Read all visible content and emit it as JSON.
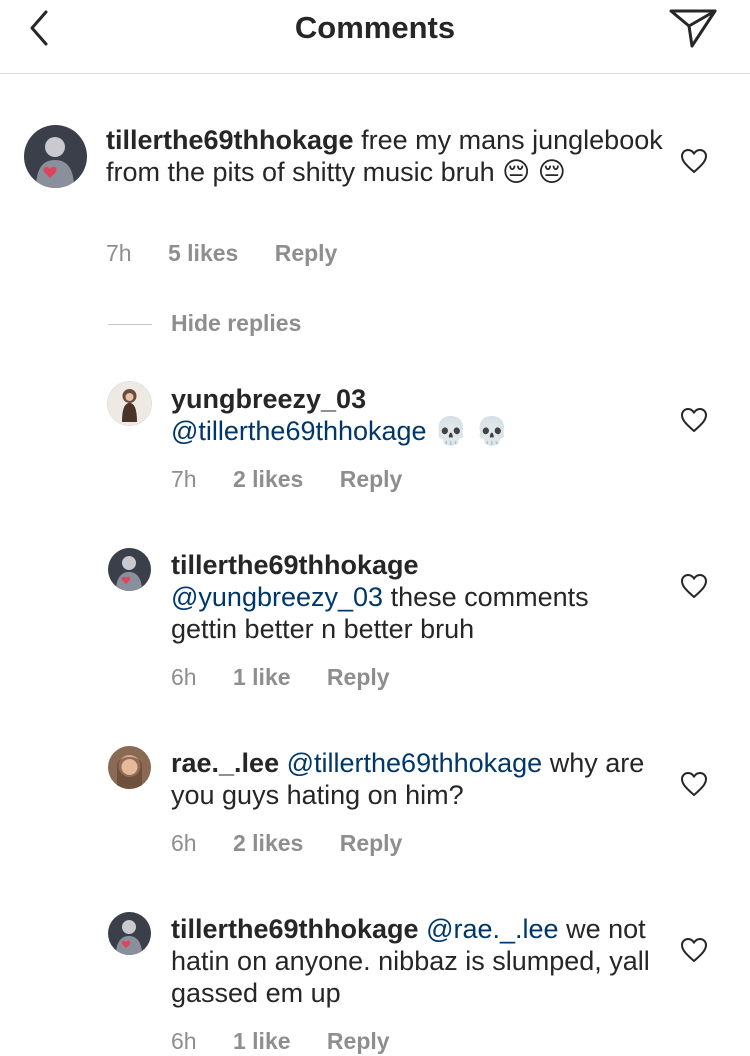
{
  "header": {
    "title": "Comments"
  },
  "hide_replies_label": "Hide replies",
  "comments": [
    {
      "username": "tillerthe69thhokage",
      "mention": "",
      "text": "free my mans junglebook from the pits of shitty music bruh 😔 😔",
      "time": "7h",
      "likes": "5 likes",
      "reply": "Reply"
    },
    {
      "username": "yungbreezy_03",
      "mention": "@tillerthe69thhokage",
      "text": "💀 💀",
      "time": "7h",
      "likes": "2 likes",
      "reply": "Reply"
    },
    {
      "username": "tillerthe69thhokage",
      "mention": "@yungbreezy_03",
      "text": "these comments gettin better n better bruh",
      "time": "6h",
      "likes": "1 like",
      "reply": "Reply"
    },
    {
      "username": "rae._.lee",
      "mention": "@tillerthe69thhokage",
      "text": "why are you guys hating on him?",
      "time": "6h",
      "likes": "2 likes",
      "reply": "Reply"
    },
    {
      "username": "tillerthe69thhokage",
      "mention": "@rae._.lee",
      "text": "we not hatin on anyone. nibbaz is slumped, yall gassed em up",
      "time": "6h",
      "likes": "1 like",
      "reply": "Reply"
    }
  ]
}
